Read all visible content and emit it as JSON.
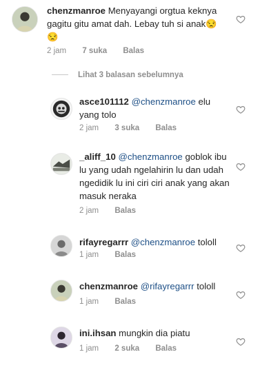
{
  "comments": [
    {
      "user": "chenzmanroe",
      "mention": "",
      "text": "Menyayangi orgtua keknya gagitu gitu amat dah. Lebay tuh si anak",
      "emoji": "😒\n😒",
      "time": "2 jam",
      "likes": "7 suka",
      "reply": "Balas",
      "avatar_icon": "user-avatar-icon"
    }
  ],
  "view_replies": "Lihat 3 balasan sebelumnya",
  "replies": [
    {
      "user": "asce101112",
      "mention": "@chenzmanroe",
      "text": "elu yang tolo",
      "time": "2 jam",
      "likes": "3 suka",
      "reply": "Balas"
    },
    {
      "user": "_aliff_10",
      "mention": "@chenzmanroe",
      "text": "goblok ibu lu yang udah ngelahirin lu dan udah ngedidik lu ini ciri ciri anak yang akan masuk neraka",
      "time": "2 jam",
      "likes": "",
      "reply": "Balas"
    },
    {
      "user": "rifayregarrr",
      "mention": "@chenzmanroe",
      "text": "tololl",
      "time": "1 jam",
      "likes": "",
      "reply": "Balas"
    },
    {
      "user": "chenzmanroe",
      "mention": "@rifayregarrr",
      "text": "tololl",
      "time": "1 jam",
      "likes": "",
      "reply": "Balas"
    },
    {
      "user": "ini.ihsan",
      "mention": "",
      "text": "mungkin dia piatu",
      "time": "1 jam",
      "likes": "2 suka",
      "reply": "Balas"
    }
  ],
  "colors": {
    "text": "#262626",
    "meta": "#8e8e8e",
    "mention": "#1d4f86",
    "background": "#ffffff"
  }
}
